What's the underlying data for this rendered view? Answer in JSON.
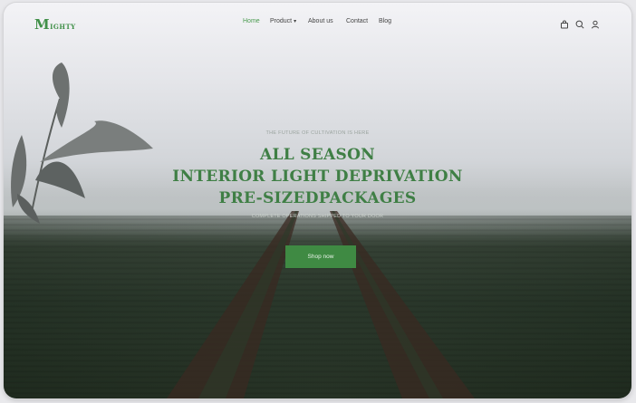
{
  "brand": {
    "logo_initial": "M",
    "logo_rest": "IGHTY",
    "color": "#3f8f47"
  },
  "nav": {
    "items": [
      {
        "label": "Home",
        "active": true
      },
      {
        "label": "Product",
        "has_dropdown": true
      },
      {
        "label": "About us"
      },
      {
        "label": "Contact"
      },
      {
        "label": "Blog"
      }
    ],
    "icons": [
      "bag-icon",
      "search-icon",
      "user-icon"
    ]
  },
  "hero": {
    "kicker": "THE FUTURE OF CULTIVATION IS HERE",
    "headline_lines": [
      "ALL SEASON",
      "INTERIOR LIGHT DEPRIVATION",
      "PRE-SIZEDPACKAGES"
    ],
    "subline": "COMPLETE OPERATIONS SHIPPED TO YOUR DOOR",
    "cta_label": "Shop now"
  },
  "colors": {
    "accent": "#3f8a43",
    "headline": "#3f7f45"
  }
}
